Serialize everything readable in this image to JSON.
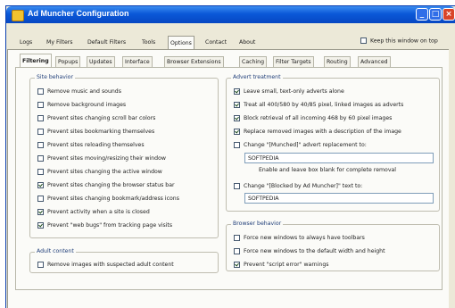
{
  "window": {
    "title": "Ad Muncher Configuration"
  },
  "tabs": [
    "Logs",
    "My Filters",
    "Default Filters",
    "Tools",
    "Options",
    "Contact",
    "About"
  ],
  "keep_window_label": "Keep this window on top",
  "subtabs": [
    "Filtering",
    "Popups",
    "Updates",
    "Interface",
    "Browser Extensions",
    "Caching",
    "Filter Targets",
    "Routing",
    "Advanced"
  ],
  "site_behavior": {
    "title": "Site behavior",
    "options": [
      {
        "label": "Remove music and sounds",
        "checked": false
      },
      {
        "label": "Remove background images",
        "checked": false
      },
      {
        "label": "Prevent sites changing scroll bar colors",
        "checked": false
      },
      {
        "label": "Prevent sites bookmarking themselves",
        "checked": false
      },
      {
        "label": "Prevent sites reloading themselves",
        "checked": false
      },
      {
        "label": "Prevent sites moving/resizing their window",
        "checked": false
      },
      {
        "label": "Prevent sites changing the active window",
        "checked": false
      },
      {
        "label": "Prevent sites changing the browser status bar",
        "checked": true
      },
      {
        "label": "Prevent sites changing bookmark/address icons",
        "checked": false
      },
      {
        "label": "Prevent activity when a site is closed",
        "checked": true
      },
      {
        "label": "Prevent \"web bugs\" from tracking page visits",
        "checked": true
      }
    ]
  },
  "adult_content": {
    "title": "Adult content",
    "options": [
      {
        "label": "Remove images with suspected adult content",
        "checked": false
      }
    ]
  },
  "advert_treatment": {
    "title": "Advert treatment",
    "options": [
      {
        "label": "Leave small, text-only adverts alone",
        "checked": true
      },
      {
        "label": "Treat all 400/580 by 40/85 pixel, linked images as adverts",
        "checked": true
      },
      {
        "label": "Block retrieval of all incoming 468 by 60 pixel images",
        "checked": true
      },
      {
        "label": "Replace removed images with a description of the image",
        "checked": true
      }
    ],
    "change_munched_label": "Change \"[Munched]\" advert replacement to:",
    "change_munched_checked": false,
    "munched_value": "SOFTPEDIA",
    "blank_note": "Enable and leave box blank for complete removal",
    "change_blocked_label": "Change \"[Blocked by Ad Muncher]\" text to:",
    "change_blocked_checked": false,
    "blocked_value": "SOFTPEDIA"
  },
  "browser_behavior": {
    "title": "Browser behavior",
    "options": [
      {
        "label": "Force new windows to always have toolbars",
        "checked": false
      },
      {
        "label": "Force new windows to the default width and height",
        "checked": false
      },
      {
        "label": "Prevent \"script error\" warnings",
        "checked": true
      }
    ]
  }
}
